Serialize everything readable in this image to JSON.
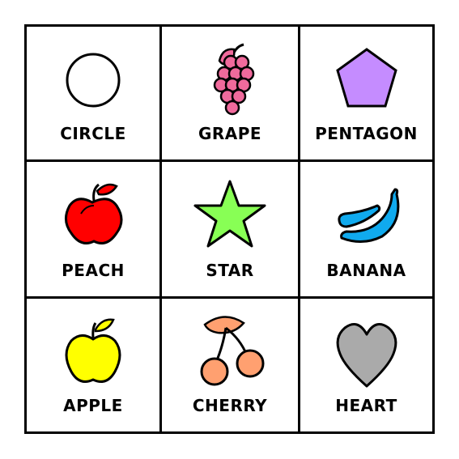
{
  "cells": [
    {
      "label": "CIRCLE",
      "icon": "circle-icon",
      "fill": "#ffffff"
    },
    {
      "label": "GRAPE",
      "icon": "grape-icon",
      "fill": "#f06a9c"
    },
    {
      "label": "PENTAGON",
      "icon": "pentagon-icon",
      "fill": "#c58cff"
    },
    {
      "label": "PEACH",
      "icon": "peach-icon",
      "fill": "#ff0000"
    },
    {
      "label": "STAR",
      "icon": "star-icon",
      "fill": "#88ff55"
    },
    {
      "label": "BANANA",
      "icon": "banana-icon",
      "fill": "#10aaee"
    },
    {
      "label": "APPLE",
      "icon": "apple-icon",
      "fill": "#ffff00"
    },
    {
      "label": "CHERRY",
      "icon": "cherry-icon",
      "fill": "#ffa070"
    },
    {
      "label": "HEART",
      "icon": "heart-icon",
      "fill": "#aaaaaa"
    }
  ]
}
